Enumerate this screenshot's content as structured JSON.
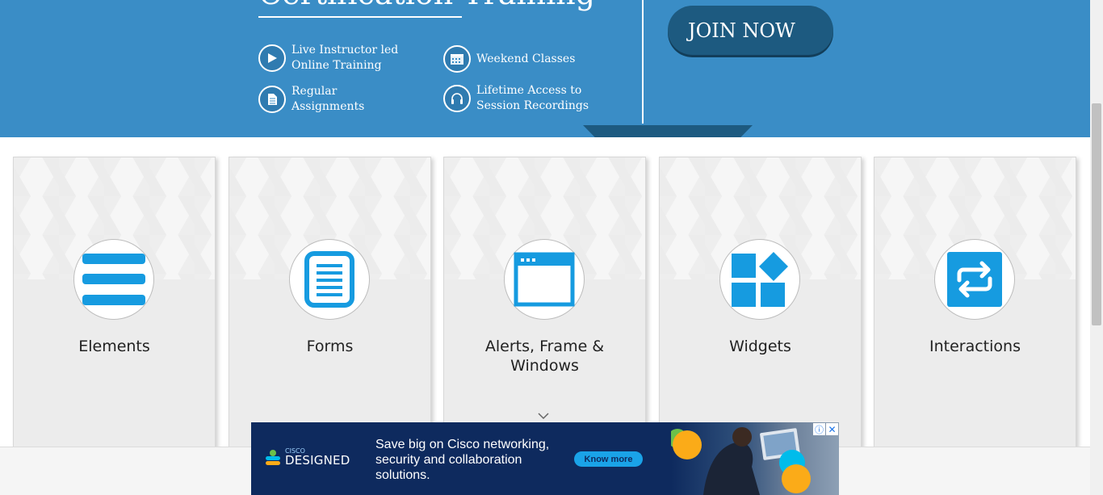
{
  "banner": {
    "title": "Certification Training",
    "features": [
      {
        "line1": "Live Instructor led",
        "line2": "Online Training",
        "icon": "play-icon"
      },
      {
        "line1": "Weekend Classes",
        "line2": "",
        "icon": "calendar-icon"
      },
      {
        "line1": "Regular",
        "line2": "Assignments",
        "icon": "document-icon"
      },
      {
        "line1": "Lifetime Access to",
        "line2": "Session Recordings",
        "icon": "headphones-icon"
      }
    ],
    "join_label": "JOIN NOW"
  },
  "cards": [
    {
      "label": "Elements",
      "icon": "hamburger-icon"
    },
    {
      "label": "Forms",
      "icon": "form-icon"
    },
    {
      "label": "Alerts, Frame & Windows",
      "icon": "window-icon"
    },
    {
      "label": "Widgets",
      "icon": "widgets-icon"
    },
    {
      "label": "Interactions",
      "icon": "repeat-icon"
    }
  ],
  "ad": {
    "brand_small": "CISCO",
    "brand": "DESIGNED",
    "copy": "Save big on Cisco networking, security and collaboration solutions.",
    "cta": "Know more",
    "info_glyph": "ⓘ",
    "close_glyph": "✕"
  },
  "colors": {
    "banner": "#3a8dc6",
    "join_button": "#1d5a80",
    "card_icon": "#169be0",
    "ad_bg": "#0e2a5e"
  }
}
